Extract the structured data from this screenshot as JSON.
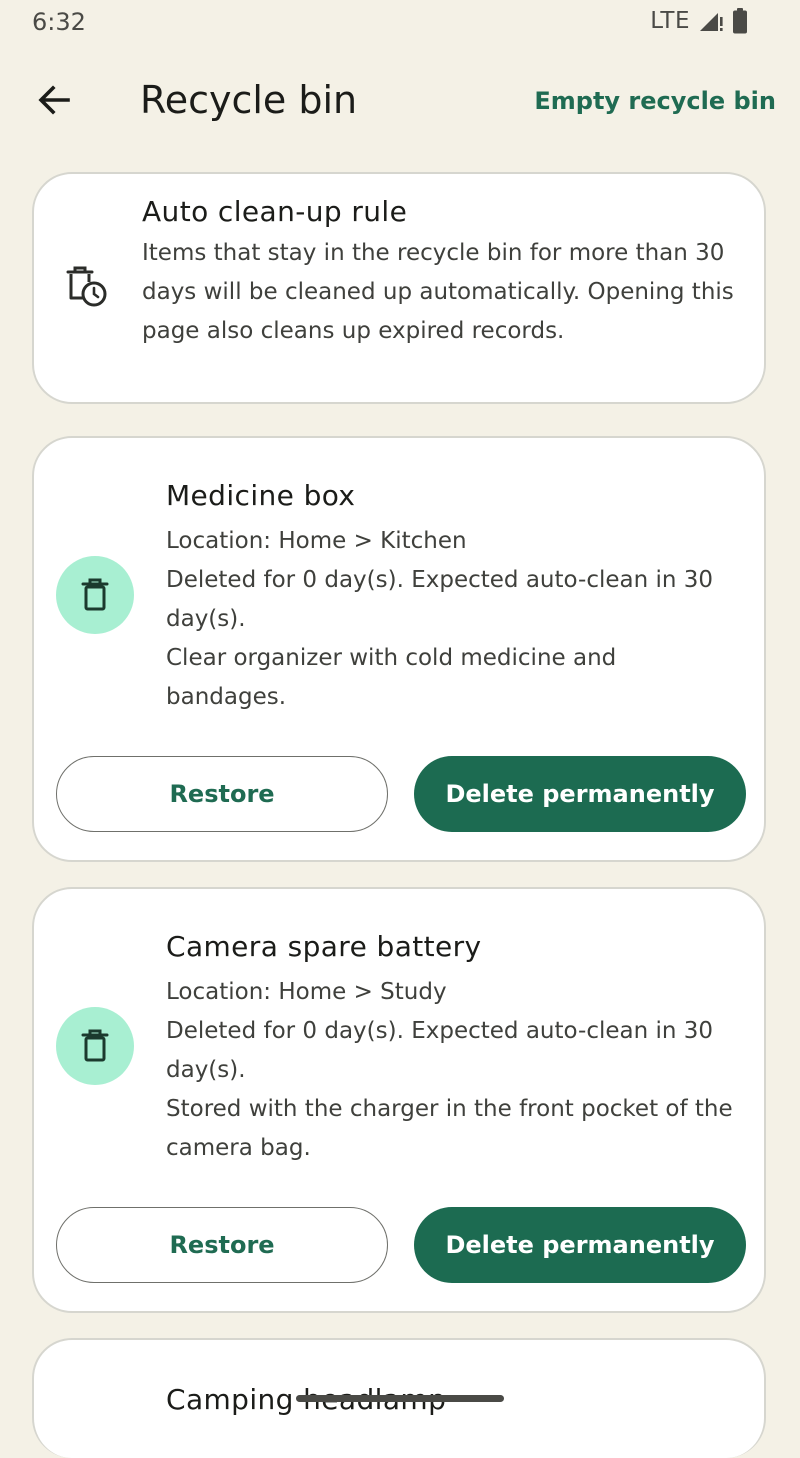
{
  "status_bar": {
    "time": "6:32",
    "network": "LTE",
    "signal_icon": "signal-icon",
    "battery_icon": "battery-icon"
  },
  "app_bar": {
    "back_icon": "arrow-left-icon",
    "title": "Recycle bin",
    "action_label": "Empty recycle bin",
    "accent_color": "#1f6b52"
  },
  "rule": {
    "icon": "trash-clock-icon",
    "title": "Auto clean-up rule",
    "text": "Items that stay in the recycle bin for more than 30 days will be cleaned up automatically. Opening this page also cleans up expired records."
  },
  "items": [
    {
      "icon": "trash-icon",
      "title": "Medicine box",
      "location": "Location: Home > Kitchen",
      "deleted_info": "Deleted for 0 day(s). Expected auto-clean in 30 day(s).",
      "description": "Clear organizer with cold medicine and bandages.",
      "restore_label": "Restore",
      "delete_label": "Delete permanently"
    },
    {
      "icon": "trash-icon",
      "title": "Camera spare battery",
      "location": "Location: Home > Study",
      "deleted_info": "Deleted for 0 day(s). Expected auto-clean in 30 day(s).",
      "description": "Stored with the charger in the front pocket of the camera bag.",
      "restore_label": "Restore",
      "delete_label": "Delete permanently"
    },
    {
      "title": "Camping headlamp"
    }
  ],
  "colors": {
    "background": "#f4f1e6",
    "primary_button": "#1c6b51",
    "icon_circle": "#a8efd2"
  }
}
